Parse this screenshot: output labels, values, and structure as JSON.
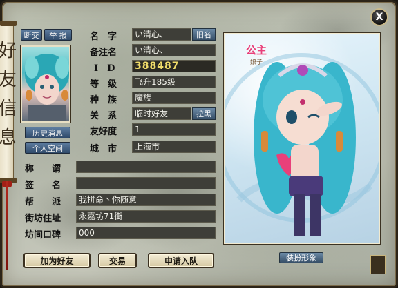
{
  "window": {
    "side_title_chars": [
      "好",
      "友",
      "信",
      "息"
    ],
    "close_label": "X"
  },
  "top_buttons": {
    "break_off": "断交",
    "report": "举 报"
  },
  "side_buttons": {
    "history": "历史消息",
    "personal": "个人空间"
  },
  "fields": {
    "name_label": "名　字",
    "name_value": "い清心、",
    "old_name_button": "旧名",
    "remark_label": "备注名",
    "remark_value": "い清心、",
    "id_label": "I　D",
    "id_value": "388487",
    "level_label": "等　级",
    "level_value": "飞升185级",
    "race_label": "种　族",
    "race_value": "魔族",
    "relation_label": "关　系",
    "relation_value": "临时好友",
    "blacklist_button": "拉黑",
    "friendship_label": "友好度",
    "friendship_value": "1",
    "city_label": "城　市",
    "city_value": "上海市",
    "title_label": "称　　谓",
    "title_value": "",
    "signature_label": "签　　名",
    "signature_value": "",
    "guild_label": "帮　　派",
    "guild_value": "我拼命丶你随意",
    "address_label": "街坊住址",
    "address_value": "永嘉坊71街",
    "reputation_label": "坊间口碑",
    "reputation_value": "000"
  },
  "portrait": {
    "badge_text": "公主",
    "badge_sub": "娘子",
    "dress_button": "装扮形象"
  },
  "actions": {
    "add_friend": "加为好友",
    "trade": "交易",
    "join_team": "申请入队"
  },
  "colors": {
    "id_value": "#f0dc6a",
    "button_blue": "#3b5878",
    "badge_pink": "#e8407a"
  }
}
